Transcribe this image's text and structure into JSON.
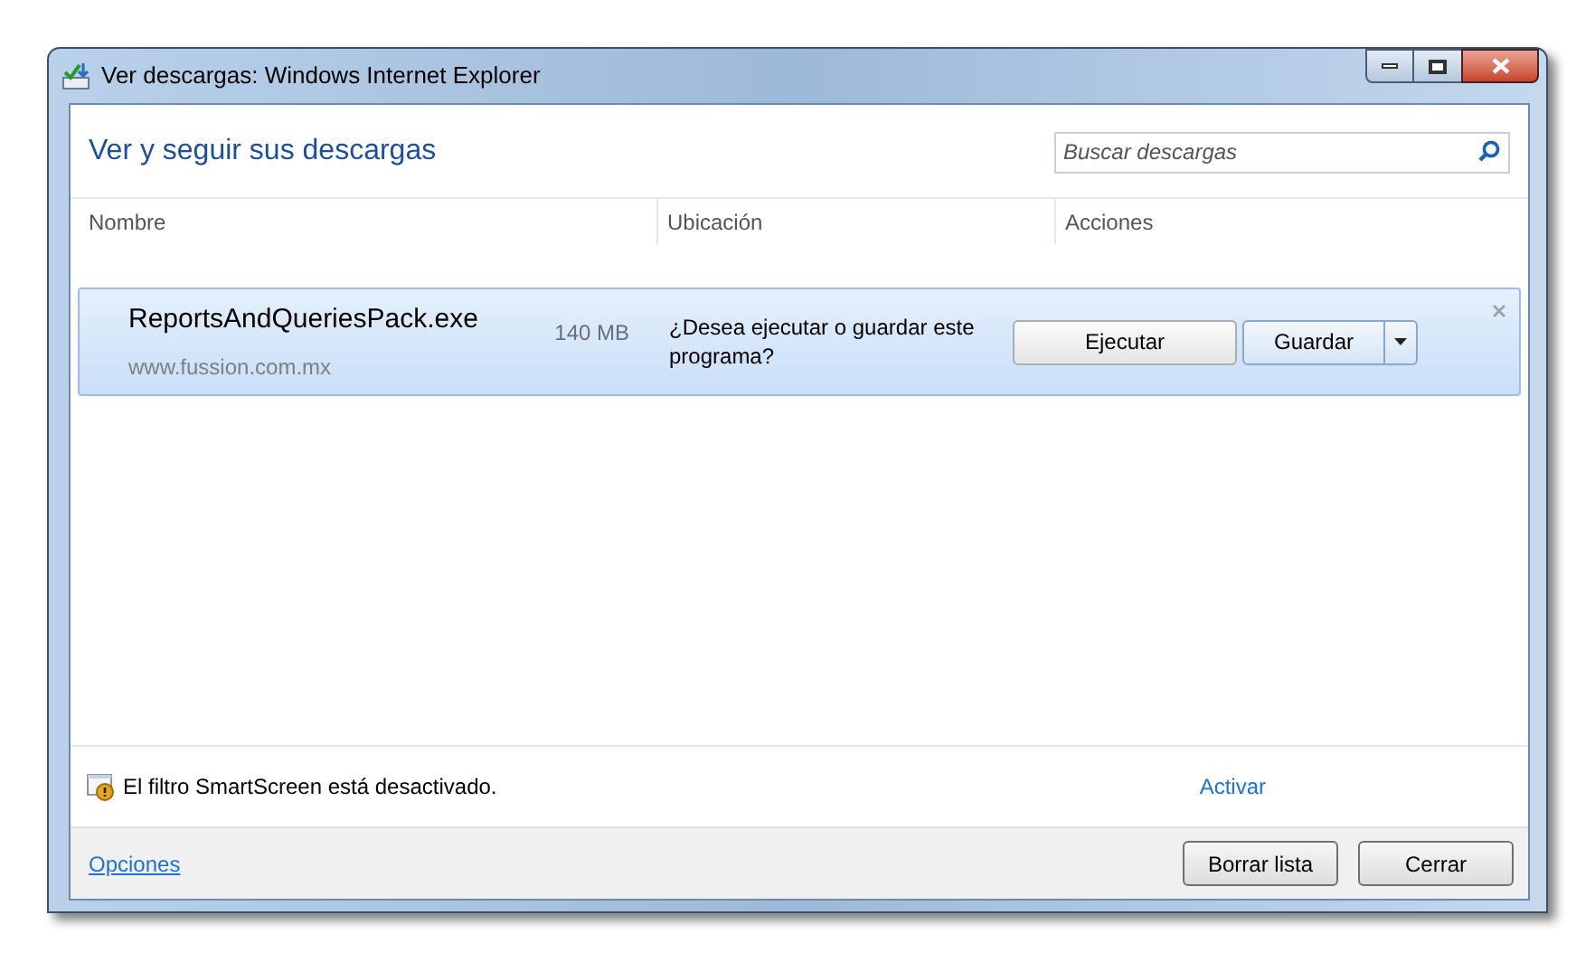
{
  "window": {
    "title": "Ver descargas: Windows Internet Explorer"
  },
  "header": {
    "title": "Ver y seguir sus descargas",
    "search": {
      "placeholder": "Buscar descargas"
    }
  },
  "columns": [
    "Nombre",
    "Ubicación",
    "Acciones"
  ],
  "downloads": [
    {
      "name": "ReportsAndQueriesPack.exe",
      "source": "www.fussion.com.mx",
      "size": "140 MB",
      "message": "¿Desea ejecutar o guardar este programa?",
      "primary_action": "Ejecutar",
      "secondary_action": "Guardar",
      "selected": true
    }
  ],
  "smartscreen": {
    "message": "El filtro SmartScreen está desactivado.",
    "link": "Activar"
  },
  "footer": {
    "link": "Opciones",
    "buttons": [
      "Borrar lista",
      "Cerrar"
    ]
  }
}
